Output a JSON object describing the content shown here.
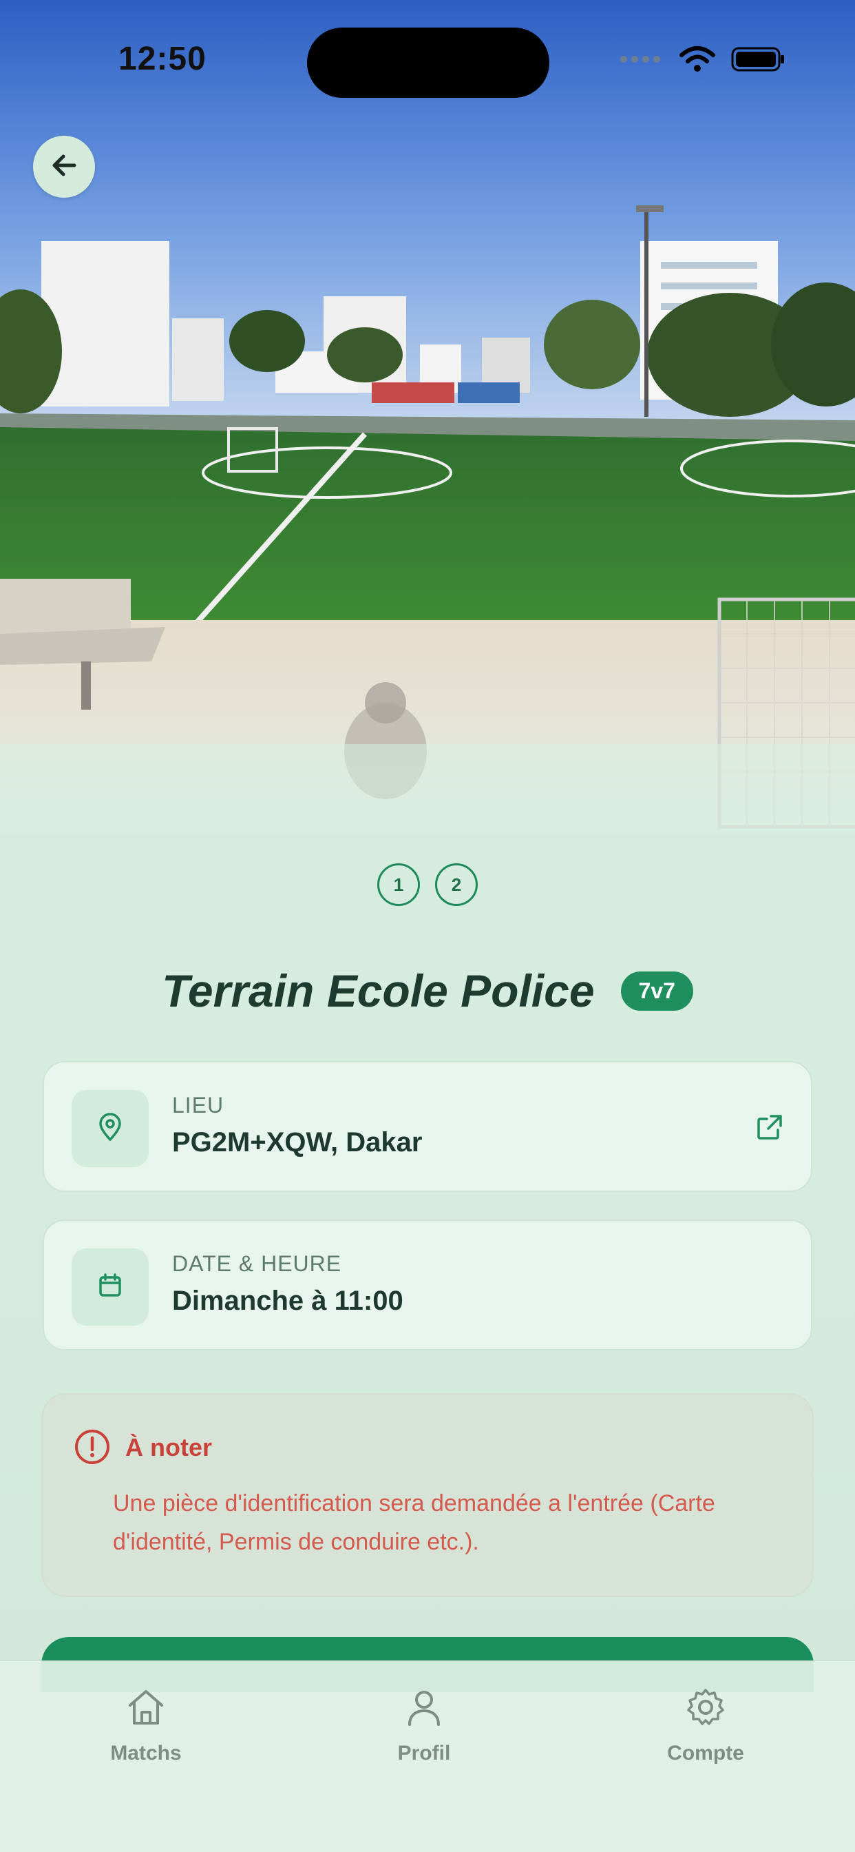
{
  "status_bar": {
    "time": "12:50"
  },
  "hero": {
    "pager": [
      "1",
      "2"
    ]
  },
  "venue": {
    "name": "Terrain Ecole Police",
    "format_badge": "7v7"
  },
  "location": {
    "label": "LIEU",
    "value": "PG2M+XQW, Dakar"
  },
  "datetime": {
    "label": "DATE & HEURE",
    "value": "Dimanche à 11:00"
  },
  "notice": {
    "title": "À noter",
    "text": "Une pièce d'identification sera demandée a l'entrée (Carte d'identité, Permis de conduire etc.)."
  },
  "tabbar": {
    "tabs": [
      {
        "label": "Matchs",
        "icon": "home-icon"
      },
      {
        "label": "Profil",
        "icon": "user-icon"
      },
      {
        "label": "Compte",
        "icon": "gear-icon"
      }
    ]
  },
  "colors": {
    "accent": "#1f8f5f",
    "warning": "#c8423a",
    "background": "#d9eee2"
  }
}
